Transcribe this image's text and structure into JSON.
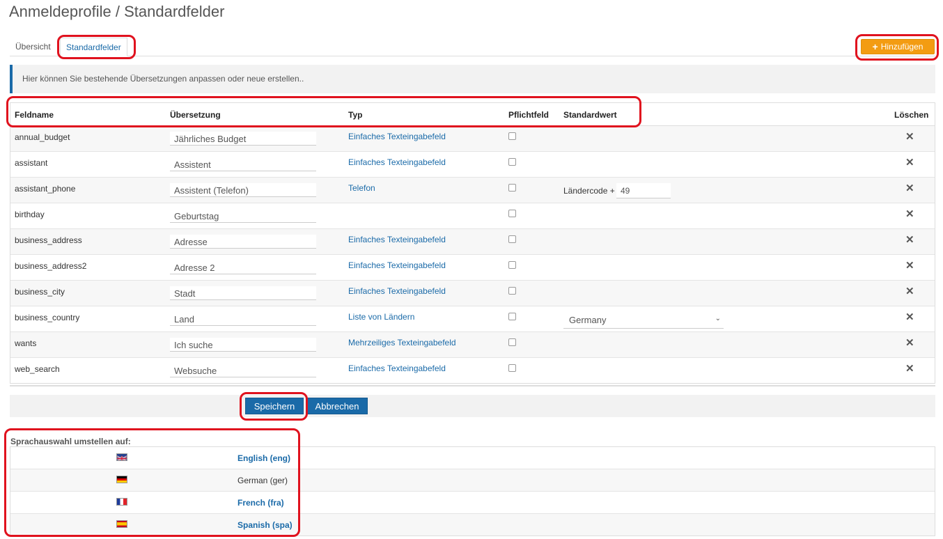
{
  "page": {
    "title": "Anmeldeprofile / Standardfelder"
  },
  "tabs": [
    {
      "label": "Übersicht",
      "active": false
    },
    {
      "label": "Standardfelder",
      "active": true
    }
  ],
  "toolbar": {
    "add_label": "Hinzufügen",
    "add_icon": "plus-icon"
  },
  "info": {
    "text": "Hier können Sie bestehende Übersetzungen anpassen oder neue erstellen.."
  },
  "grid": {
    "columns": [
      "Feldname",
      "Übersetzung",
      "Typ",
      "Pflichtfeld",
      "Standardwert",
      "Löschen"
    ],
    "rows": [
      {
        "name": "annual_budget",
        "translation": "Jährliches Budget",
        "type": "Einfaches Texteingabefeld",
        "required": false
      },
      {
        "name": "assistant",
        "translation": "Assistent",
        "type": "Einfaches Texteingabefeld",
        "required": false
      },
      {
        "name": "assistant_phone",
        "translation": "Assistent (Telefon)",
        "type": "Telefon",
        "required": false,
        "default_label": "Ländercode +",
        "default_value": "49"
      },
      {
        "name": "birthday",
        "translation": "Geburtstag",
        "type": "",
        "required": false
      },
      {
        "name": "business_address",
        "translation": "Adresse",
        "type": "Einfaches Texteingabefeld",
        "required": false
      },
      {
        "name": "business_address2",
        "translation": "Adresse 2",
        "type": "Einfaches Texteingabefeld",
        "required": false
      },
      {
        "name": "business_city",
        "translation": "Stadt",
        "type": "Einfaches Texteingabefeld",
        "required": false
      },
      {
        "name": "business_country",
        "translation": "Land",
        "type": "Liste von Ländern",
        "required": false,
        "default_select": "Germany"
      },
      {
        "name": "wants",
        "translation": "Ich suche",
        "type": "Mehrzeiliges Texteingabefeld",
        "required": false
      },
      {
        "name": "web_search",
        "translation": "Websuche",
        "type": "Einfaches Texteingabefeld",
        "required": false
      }
    ],
    "delete_icon": "close-icon"
  },
  "actions": {
    "save_label": "Speichern",
    "cancel_label": "Abbrechen"
  },
  "languages": {
    "title": "Sprachauswahl umstellen auf:",
    "items": [
      {
        "label": "English (eng)",
        "flag": "uk-flag-icon",
        "current": false
      },
      {
        "label": "German (ger)",
        "flag": "germany-flag-icon",
        "current": true
      },
      {
        "label": "French (fra)",
        "flag": "france-flag-icon",
        "current": false
      },
      {
        "label": "Spanish (spa)",
        "flag": "spain-flag-icon",
        "current": false
      }
    ]
  },
  "colors": {
    "accent": "#1a6aa8",
    "add_button": "#f39c12",
    "highlight": "#e0121e"
  }
}
